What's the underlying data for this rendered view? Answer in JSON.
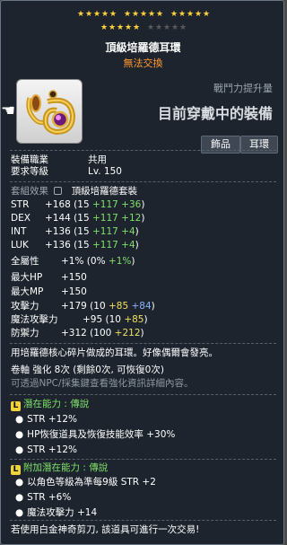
{
  "stars": {
    "row1": [
      true,
      true,
      true,
      true,
      true,
      true,
      true,
      true,
      true,
      true,
      true,
      true,
      true,
      true,
      true
    ],
    "row2": [
      true,
      true,
      true,
      true,
      true,
      false,
      false,
      false,
      false,
      false
    ]
  },
  "item": {
    "name": "頂級培羅德耳環",
    "trade": "無法交換",
    "combat_power_label": "戰鬥力提升量",
    "equipped_text": "目前穿戴中的裝備",
    "tags": [
      "飾品",
      "耳環"
    ]
  },
  "info": {
    "job_label": "裝備職業",
    "job_value": "共用",
    "level_label": "要求等級",
    "level_value": "Lv. 150"
  },
  "set": {
    "label": "套組效果",
    "name": "頂級培羅德套裝"
  },
  "stats": [
    {
      "name": "STR",
      "total": "+168",
      "open": " (15 ",
      "flame": "+117",
      "star": " +36",
      "close": ")"
    },
    {
      "name": "DEX",
      "total": "+144",
      "open": " (15 ",
      "flame": "+117",
      "star": " +12",
      "close": ")"
    },
    {
      "name": "INT",
      "total": "+136",
      "open": " (15 ",
      "flame": "+117",
      "star": " +4",
      "close": ")"
    },
    {
      "name": "LUK",
      "total": "+136",
      "open": " (15 ",
      "flame": "+117",
      "star": " +4",
      "close": ")"
    }
  ],
  "extra_stats": {
    "allstat_label": "全屬性",
    "allstat_total": "+1%",
    "allstat_open": " (0% ",
    "allstat_star": "+1%",
    "allstat_close": ")",
    "hp_label": "最大HP",
    "hp_value": "+150",
    "mp_label": "最大MP",
    "mp_value": "+150",
    "atk_label": "攻擊力",
    "atk_total": "+179",
    "atk_open": " (10 ",
    "atk_flame": "+85",
    "atk_star": " +84",
    "atk_close": ")",
    "matk_label": "魔法攻擊力",
    "matk_total": "+95",
    "matk_open": " (10 ",
    "matk_flame": "+85",
    "matk_close": ")",
    "def_label": "防禦力",
    "def_total": "+312",
    "def_open": " (100 ",
    "def_flame": "+212",
    "def_close": ")"
  },
  "description": {
    "text": "用培羅德核心碎片做成的耳環。好像偶爾會發亮。",
    "scroll": "卷軸 強化 8次 (剩餘0次, 可恢復0次)",
    "npc_note": "可透過NPC/採集鍵查看強化資訊詳細內容。"
  },
  "potential": {
    "badge": "L",
    "title": "潛在能力 : 傳說",
    "lines": [
      "STR +12%",
      "HP恢復道具及恢復技能效率 +30%",
      "STR +12%"
    ]
  },
  "additional": {
    "badge": "L",
    "title": "附加潛在能力 : 傳說",
    "lines": [
      "以角色等級為準每9級 STR +2",
      "STR +6%",
      "魔法攻擊力 +14"
    ]
  },
  "footer": "若使用白金神奇剪刀, 該道具可進行一次交易!",
  "icons": {
    "item": "earring-icon",
    "cursor": "hand-cursor-icon",
    "set": "lock-icon"
  },
  "colors": {
    "trade": "#ff9a30",
    "flame": "#7ee06a",
    "star": "#88b4ff",
    "legendary": "#7bd654",
    "badge": "#f0d23a"
  }
}
